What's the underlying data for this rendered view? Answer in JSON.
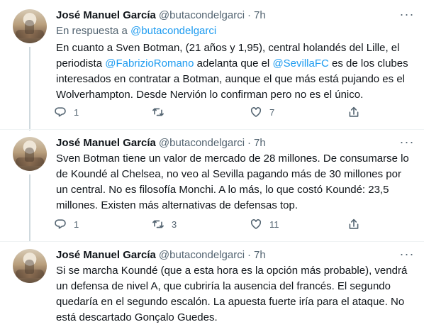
{
  "tweets": [
    {
      "author": "José Manuel García",
      "handle": "@butacondelgarci",
      "time": "7h",
      "reply_prefix": "En respuesta a ",
      "reply_handle": "@butacondelgarci",
      "text_parts": [
        "En cuanto a Sven Botman, (21 años y 1,95), central holandés del Lille, el periodista ",
        "@FabrizioRomano",
        " adelanta que el ",
        "@SevillaFC",
        " es de los clubes interesados en contratar a Botman, aunque el que más está pujando es el Wolverhampton. Desde Nervión lo confirman pero no es el único."
      ],
      "reply_count": "1",
      "retweet_count": "",
      "like_count": "7"
    },
    {
      "author": "José Manuel García",
      "handle": "@butacondelgarci",
      "time": "7h",
      "text": "Sven Botman tiene un valor de mercado de 28 millones. De consumarse lo de Koundé al Chelsea, no veo al Sevilla pagando más de 30 millones por un central. No es filosofía Monchi. A lo más, lo que costó Koundé: 23,5 millones. Existen más alternativas de defensas top.",
      "reply_count": "1",
      "retweet_count": "3",
      "like_count": "11"
    },
    {
      "author": "José Manuel García",
      "handle": "@butacondelgarci",
      "time": "7h",
      "text": "Si se marcha Koundé (que a esta hora es la opción más probable), vendrá un defensa de nivel A, que cubriría la ausencia del francés. El segundo quedaría en el segundo escalón. La apuesta fuerte iría para el ataque. No está descartado Gonçalo Guedes."
    }
  ],
  "ui": {
    "dot": "·",
    "more_label": "···",
    "icons": [
      "reply-icon",
      "retweet-icon",
      "like-icon",
      "share-icon",
      "more-icon",
      "avatar"
    ]
  },
  "colors": {
    "text": "#0f1419",
    "secondary": "#536471",
    "link": "#1d9bf0",
    "divider": "#eff3f4",
    "thread_line": "#cfd9de"
  }
}
